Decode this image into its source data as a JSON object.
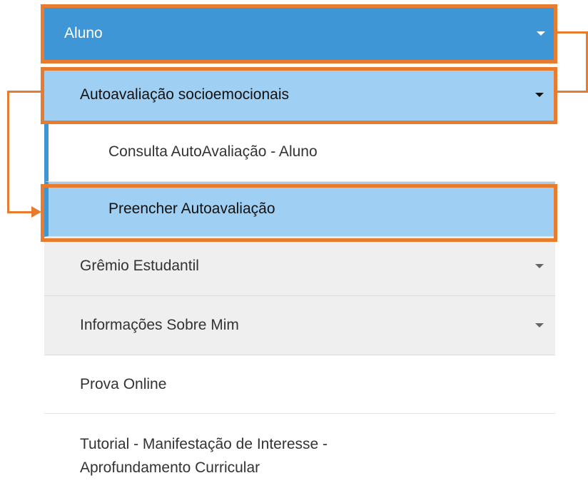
{
  "menu": {
    "aluno_label": "Aluno",
    "autoavaliacao_label": "Autoavaliação socioemocionais",
    "sub_items": {
      "consulta": "Consulta AutoAvaliação - Aluno",
      "preencher": "Preencher Autoavaliação"
    },
    "gremio_label": "Grêmio Estudantil",
    "informacoes_label": "Informações Sobre Mim",
    "prova_label": "Prova Online",
    "tutorial_line1": "Tutorial - Manifestação de Interesse -",
    "tutorial_line2": "Aprofundamento Curricular"
  },
  "colors": {
    "primary_blue": "#3e96d6",
    "light_blue": "#9fd0f3",
    "annotation_orange": "#e87c2e",
    "gray_bg": "#efefef"
  },
  "icons": {
    "dropdown": "caret-down-icon",
    "annotation_arrow": "arrow-right-icon"
  }
}
